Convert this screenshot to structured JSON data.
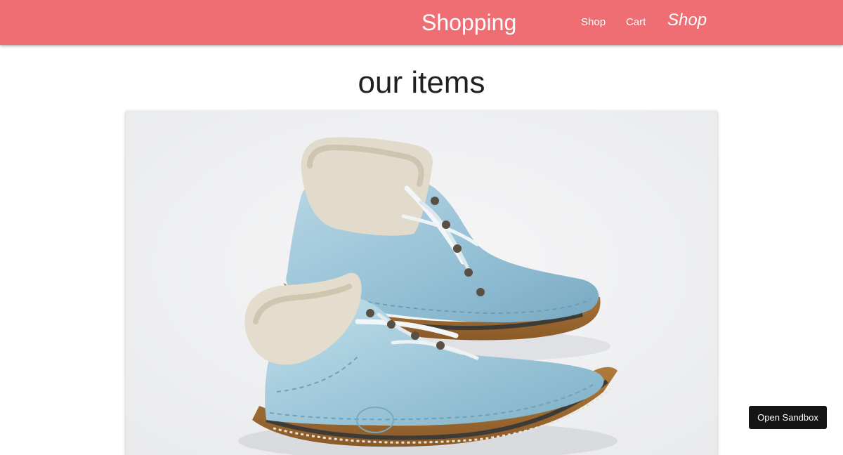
{
  "navbar": {
    "brand": "Shopping",
    "links": [
      "Shop",
      "Cart"
    ],
    "highlight_link": "Shop",
    "background_color": "#ee6e73"
  },
  "main": {
    "title": "our items",
    "product_image": {
      "subject": "pair of light blue leather boots with fleece lining"
    }
  },
  "sandbox": {
    "button_label": "Open Sandbox"
  }
}
